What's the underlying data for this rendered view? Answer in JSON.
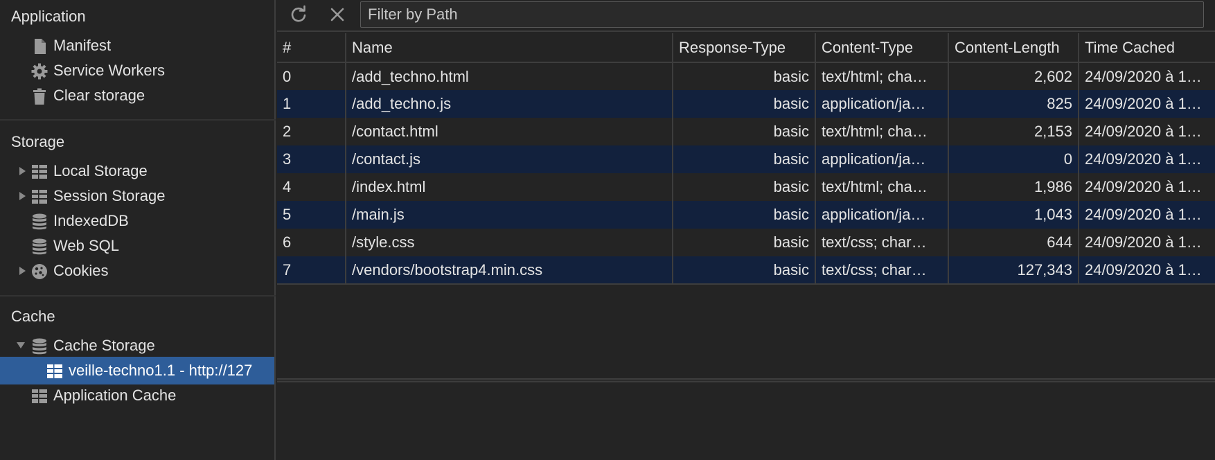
{
  "sidebar": {
    "application": {
      "title": "Application",
      "items": [
        {
          "label": "Manifest",
          "icon": "document-icon"
        },
        {
          "label": "Service Workers",
          "icon": "gear-icon"
        },
        {
          "label": "Clear storage",
          "icon": "trash-icon"
        }
      ]
    },
    "storage": {
      "title": "Storage",
      "items": [
        {
          "label": "Local Storage",
          "icon": "grid-icon",
          "expandable": true
        },
        {
          "label": "Session Storage",
          "icon": "grid-icon",
          "expandable": true
        },
        {
          "label": "IndexedDB",
          "icon": "database-icon"
        },
        {
          "label": "Web SQL",
          "icon": "database-icon"
        },
        {
          "label": "Cookies",
          "icon": "cookie-icon",
          "expandable": true
        }
      ]
    },
    "cache": {
      "title": "Cache",
      "items": [
        {
          "label": "Cache Storage",
          "icon": "database-icon",
          "expanded": true
        },
        {
          "label": "veille-techno1.1 - http://127",
          "icon": "grid-icon",
          "selected": true
        },
        {
          "label": "Application Cache",
          "icon": "grid-icon"
        }
      ]
    }
  },
  "toolbar": {
    "refresh_icon": "refresh-icon",
    "clear_icon": "close-icon",
    "filter_placeholder": "Filter by Path"
  },
  "table": {
    "columns": [
      "#",
      "Name",
      "Response-Type",
      "Content-Type",
      "Content-Length",
      "Time Cached"
    ],
    "rows": [
      {
        "index": "0",
        "name": "/add_techno.html",
        "response_type": "basic",
        "content_type": "text/html; cha…",
        "content_length": "2,602",
        "time_cached": "24/09/2020 à 1…"
      },
      {
        "index": "1",
        "name": "/add_techno.js",
        "response_type": "basic",
        "content_type": "application/ja…",
        "content_length": "825",
        "time_cached": "24/09/2020 à 1…"
      },
      {
        "index": "2",
        "name": "/contact.html",
        "response_type": "basic",
        "content_type": "text/html; cha…",
        "content_length": "2,153",
        "time_cached": "24/09/2020 à 1…"
      },
      {
        "index": "3",
        "name": "/contact.js",
        "response_type": "basic",
        "content_type": "application/ja…",
        "content_length": "0",
        "time_cached": "24/09/2020 à 1…"
      },
      {
        "index": "4",
        "name": "/index.html",
        "response_type": "basic",
        "content_type": "text/html; cha…",
        "content_length": "1,986",
        "time_cached": "24/09/2020 à 1…"
      },
      {
        "index": "5",
        "name": "/main.js",
        "response_type": "basic",
        "content_type": "application/ja…",
        "content_length": "1,043",
        "time_cached": "24/09/2020 à 1…"
      },
      {
        "index": "6",
        "name": "/style.css",
        "response_type": "basic",
        "content_type": "text/css; char…",
        "content_length": "644",
        "time_cached": "24/09/2020 à 1…"
      },
      {
        "index": "7",
        "name": "/vendors/bootstrap4.min.css",
        "response_type": "basic",
        "content_type": "text/css; char…",
        "content_length": "127,343",
        "time_cached": "24/09/2020 à 1…"
      }
    ]
  },
  "colors": {
    "background": "#242424",
    "selected_row": "#12213d",
    "sidebar_selected": "#2e5d99",
    "border": "#3d3d3d",
    "text": "#e3e3e3"
  }
}
